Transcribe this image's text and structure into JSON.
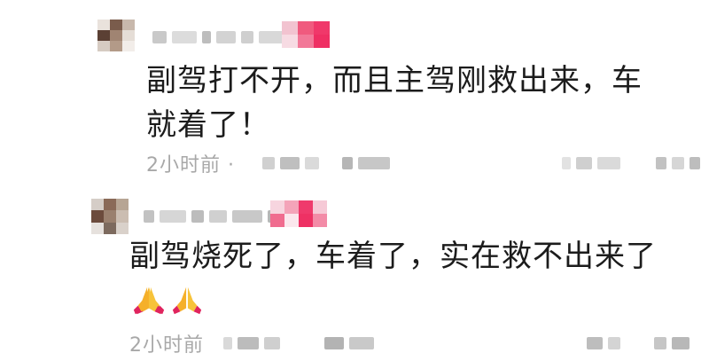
{
  "comments": [
    {
      "text": "副驾打不开，而且主驾刚救出来，车就着了！",
      "time": "2小时前 ·"
    },
    {
      "text": "副驾烧死了，车着了，实在救不出来了",
      "emoji": "folded-hands",
      "time": "2小时前"
    }
  ],
  "colors": {
    "text": "#1c1c1c",
    "meta": "#a8a8a8",
    "badge": "#f0386a"
  }
}
